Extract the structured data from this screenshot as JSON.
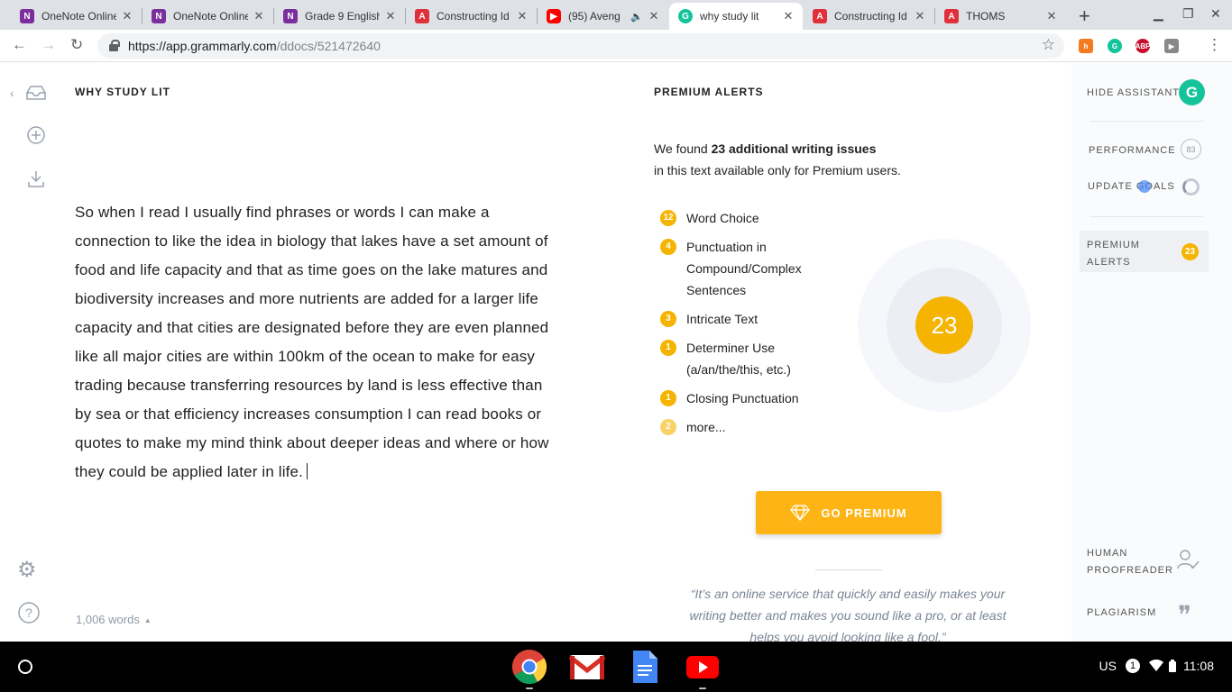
{
  "browser": {
    "tabs": [
      {
        "title": "OneNote Online",
        "icon": "onenote-icon",
        "active": false
      },
      {
        "title": "OneNote Online",
        "icon": "onenote-icon",
        "active": false
      },
      {
        "title": "Grade 9 English",
        "icon": "onenote-icon",
        "active": false
      },
      {
        "title": "Constructing Id",
        "icon": "pdf-icon",
        "active": false
      },
      {
        "title": "(95) Aveng",
        "icon": "youtube-icon",
        "active": false
      },
      {
        "title": "why study lit",
        "icon": "grammarly-icon",
        "active": true
      },
      {
        "title": "Constructing Id",
        "icon": "pdf-icon",
        "active": false
      },
      {
        "title": "THOMS",
        "icon": "pdf-icon",
        "active": false
      }
    ],
    "url_host": "https://app.grammarly.com",
    "url_path": "/ddocs/521472640"
  },
  "editor": {
    "doc_title": "WHY STUDY LIT",
    "text": "So when I read I usually find phrases or words I can make a connection to like the idea in biology that lakes have a set amount of food and life capacity and that as time goes on the lake matures and biodiversity increases and more nutrients are added for a larger life capacity and that cities are designated before they are even planned like all major cities are within 100km of the ocean to make for easy trading because transferring resources by land is less effective than by sea or that efficiency increases consumption I can read books or quotes to make my mind think about deeper ideas and where or how they could be applied later in life.",
    "word_count": "1,006 words"
  },
  "premium": {
    "title": "PREMIUM ALERTS",
    "found_prefix": "We found ",
    "found_bold": "23 additional writing issues",
    "found_suffix": "in this text available only for Premium users.",
    "issues": [
      {
        "count": "12",
        "label": "Word Choice"
      },
      {
        "count": "4",
        "label": "Punctuation in Compound/Complex Sentences"
      },
      {
        "count": "3",
        "label": "Intricate Text"
      },
      {
        "count": "1",
        "label": "Determiner Use (a/an/the/this, etc.)"
      },
      {
        "count": "1",
        "label": "Closing Punctuation"
      },
      {
        "count": "2",
        "label": "more..."
      }
    ],
    "total": "23",
    "button_label": "GO PREMIUM",
    "quote": "“It’s an online service that quickly and easily makes your writing better and makes you sound like a pro, or at least helps you avoid looking like a fool.”"
  },
  "assistant": {
    "hide_label": "HIDE ASSISTANT",
    "performance_label": "PERFORMANCE",
    "performance_score": "83",
    "goals_label": "UPDATE GOALS",
    "alerts_label": "PREMIUM ALERTS",
    "alerts_count": "23",
    "proofreader_label": "HUMAN PROOFREADER",
    "plagiarism_label": "PLAGIARISM"
  },
  "shelf": {
    "ime": "US",
    "notifications": "1",
    "time": "11:08"
  },
  "colors": {
    "accent": "#f5b400",
    "grammarly_green": "#15c39a"
  }
}
